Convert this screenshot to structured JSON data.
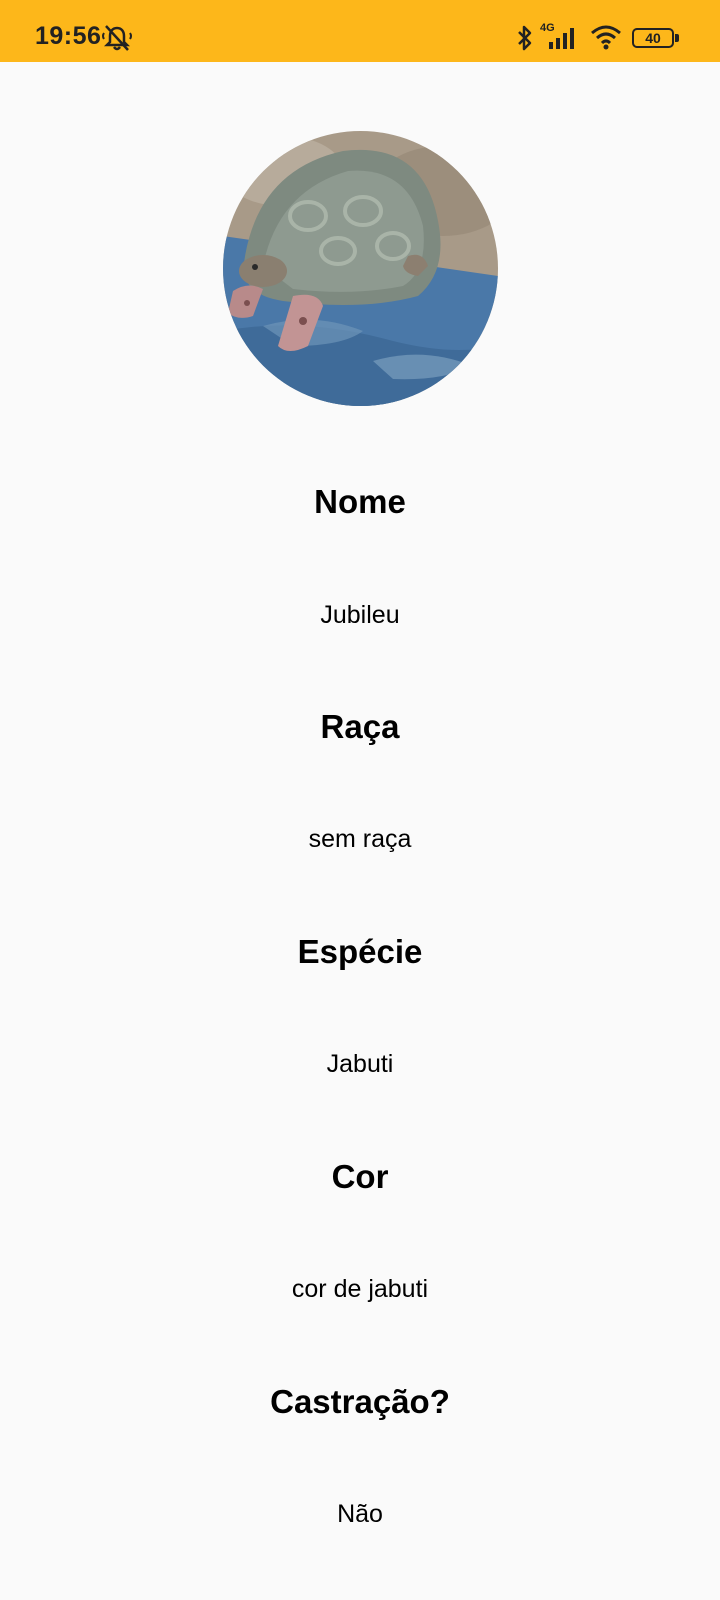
{
  "status_bar": {
    "time": "19:56",
    "network": "4G",
    "battery": "40",
    "background": "#fdb71a"
  },
  "pet": {
    "avatar_icon": "turtle-photo",
    "fields": [
      {
        "label": "Nome",
        "value": "Jubileu"
      },
      {
        "label": "Raça",
        "value": "sem raça"
      },
      {
        "label": "Espécie",
        "value": "Jabuti"
      },
      {
        "label": "Cor",
        "value": "cor de jabuti"
      },
      {
        "label": "Castração?",
        "value": "Não"
      }
    ]
  }
}
